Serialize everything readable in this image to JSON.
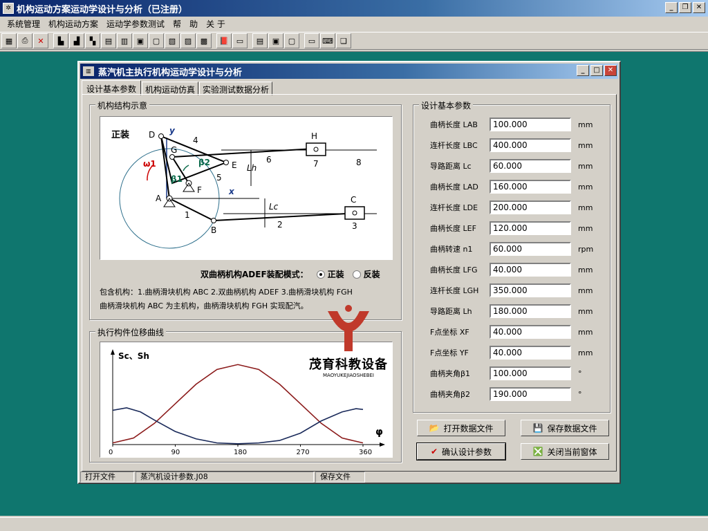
{
  "app": {
    "title": "机构运动方案运动学设计与分析（已注册）",
    "icon": "app-icon"
  },
  "menu": [
    "系统管理",
    "机构运动方案",
    "运动学参数测试",
    "帮",
    "助",
    "关 于"
  ],
  "child": {
    "title": "蒸汽机主执行机构运动学设计与分析",
    "tabs": [
      "设计基本参数",
      "机构运动仿真",
      "实验测试数据分析"
    ],
    "structure_group": "机构结构示意",
    "diagram": {
      "mode_label": "正装",
      "points": [
        "D",
        "G",
        "E",
        "F",
        "A",
        "B",
        "H",
        "C"
      ],
      "links": [
        "1",
        "2",
        "3",
        "4",
        "5",
        "6",
        "7",
        "8"
      ],
      "omega": "ω1",
      "beta1": "β1",
      "beta2": "β2",
      "x": "x",
      "y": "y",
      "Lh": "Lh",
      "Lc": "Lc"
    },
    "assembly": {
      "label": "双曲柄机构ADEF装配模式：",
      "option1": "正装",
      "option2": "反装",
      "selected": "正装"
    },
    "desc_line1": "包含机构：1.曲柄滑块机构 ABC   2.双曲柄机构 ADEF   3.曲柄滑块机构 FGH",
    "desc_line2": "曲柄滑块机构 ABC 为主机构，曲柄滑块机构 FGH 实现配汽。",
    "curve_group": "执行构件位移曲线",
    "params_group": "设计基本参数",
    "params": [
      {
        "label": "曲柄长度 LAB",
        "value": "100.000",
        "unit": "mm"
      },
      {
        "label": "连杆长度 LBC",
        "value": "400.000",
        "unit": "mm"
      },
      {
        "label": "导路距离 Lc",
        "value": "60.000",
        "unit": "mm"
      },
      {
        "label": "曲柄长度 LAD",
        "value": "160.000",
        "unit": "mm"
      },
      {
        "label": "连杆长度 LDE",
        "value": "200.000",
        "unit": "mm"
      },
      {
        "label": "曲柄长度 LEF",
        "value": "120.000",
        "unit": "mm"
      },
      {
        "label": "曲柄转速 n1",
        "value": "60.000",
        "unit": "rpm"
      },
      {
        "label": "曲柄长度 LFG",
        "value": "40.000",
        "unit": "mm"
      },
      {
        "label": "连杆长度 LGH",
        "value": "350.000",
        "unit": "mm"
      },
      {
        "label": "导路距离 Lh",
        "value": "180.000",
        "unit": "mm"
      },
      {
        "label": "F点坐标 XF",
        "value": "40.000",
        "unit": "mm"
      },
      {
        "label": "F点坐标 YF",
        "value": "40.000",
        "unit": "mm"
      },
      {
        "label": "曲柄夹角β1",
        "value": "100.000",
        "unit": "°"
      },
      {
        "label": "曲柄夹角β2",
        "value": "190.000",
        "unit": "°"
      }
    ],
    "buttons": {
      "open": "打开数据文件",
      "save": "保存数据文件",
      "confirm": "确认设计参数",
      "close": "关闭当前窗体"
    },
    "status": [
      "打开文件",
      "蒸汽机设计参数.J08",
      "保存文件"
    ]
  },
  "watermark": {
    "name": "茂育科教设备",
    "sub": "MAOYUKEJIAOSHEBEI"
  },
  "chart_data": {
    "type": "line",
    "ylabel": "Sc、Sh",
    "xlabel": "φ",
    "xlim": [
      0,
      360
    ],
    "xticks": [
      0,
      90,
      180,
      270,
      360
    ],
    "series": [
      {
        "name": "Sc",
        "color": "#8b1a1a",
        "x": [
          0,
          30,
          60,
          90,
          120,
          150,
          180,
          210,
          240,
          270,
          300,
          330,
          360
        ],
        "y": [
          0.02,
          0.08,
          0.26,
          0.5,
          0.74,
          0.92,
          0.98,
          0.92,
          0.74,
          0.5,
          0.26,
          0.08,
          0.02
        ]
      },
      {
        "name": "Sh",
        "color": "#1a2a5a",
        "x": [
          0,
          20,
          40,
          60,
          90,
          120,
          150,
          180,
          210,
          240,
          270,
          300,
          330,
          350,
          360
        ],
        "y": [
          0.42,
          0.45,
          0.4,
          0.3,
          0.16,
          0.07,
          0.02,
          0.01,
          0.02,
          0.05,
          0.14,
          0.29,
          0.4,
          0.44,
          0.43
        ]
      }
    ],
    "ylim": [
      0,
      1.05
    ]
  }
}
